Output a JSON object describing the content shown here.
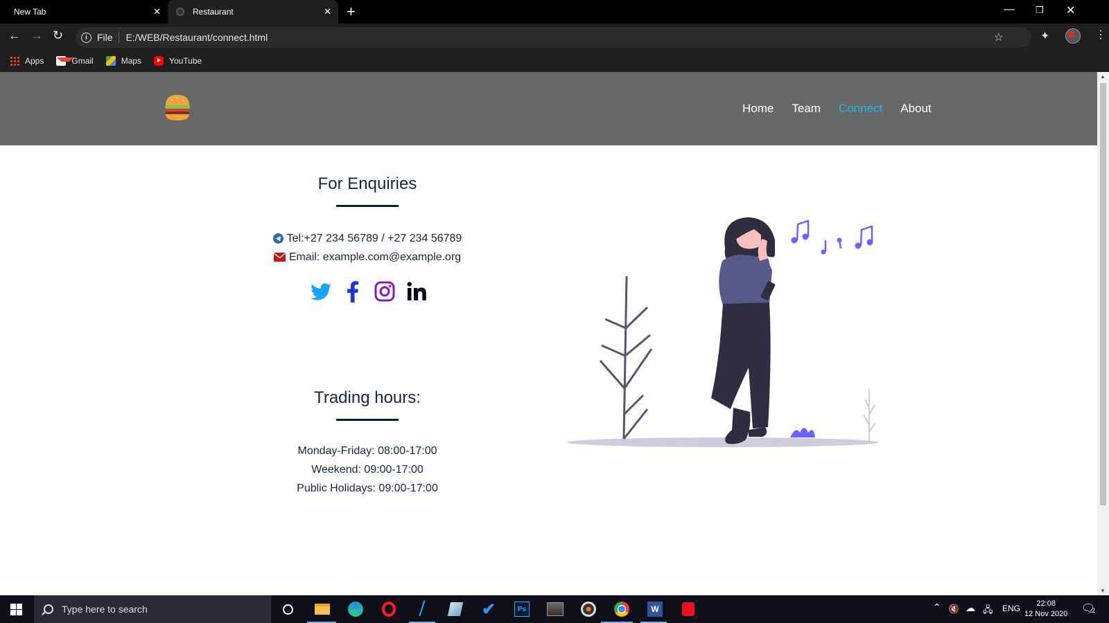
{
  "browser": {
    "tabs": [
      {
        "title": "New Tab",
        "active": false
      },
      {
        "title": "Restaurant",
        "active": true
      }
    ],
    "url_scheme": "File",
    "url": "E:/WEB/Restaurant/connect.html",
    "bookmarks": [
      {
        "label": "Apps",
        "icon": "apps-icon"
      },
      {
        "label": "Gmail",
        "icon": "gmail-icon"
      },
      {
        "label": "Maps",
        "icon": "maps-icon"
      },
      {
        "label": "YouTube",
        "icon": "youtube-icon"
      }
    ]
  },
  "site": {
    "logo": "burger-icon",
    "nav": [
      {
        "label": "Home",
        "active": false
      },
      {
        "label": "Team",
        "active": false
      },
      {
        "label": "Connect",
        "active": true
      },
      {
        "label": "About",
        "active": false
      }
    ],
    "enquiries": {
      "title": "For Enquiries",
      "tel": "Tel:+27 234 56789 / +27 234 56789",
      "email": "Email: example.com@example.org",
      "socials": [
        "twitter-icon",
        "facebook-icon",
        "instagram-icon",
        "linkedin-icon"
      ]
    },
    "hours": {
      "title": "Trading hours:",
      "lines": [
        "Monday-Friday: 08:00-17:00",
        "Weekend: 09:00-17:00",
        "Public Holidays: 09:00-17:00"
      ]
    }
  },
  "taskbar": {
    "search_placeholder": "Type here to search",
    "language": "ENG",
    "time": "22:08",
    "date": "12 Nov 2020",
    "notification_count": "2"
  },
  "colors": {
    "header_bg": "#686868",
    "nav_active": "#1fb5e8",
    "text_dark": "#1a2541",
    "accent_purple": "#6c63ff"
  }
}
